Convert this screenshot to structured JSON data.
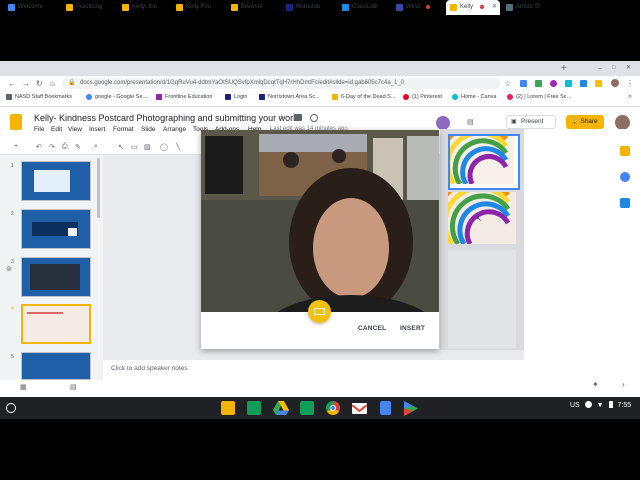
{
  "tabs": [
    {
      "label": "Welcome",
      "color": "#4285f4"
    },
    {
      "label": "Practicing",
      "color": "#f4b400"
    },
    {
      "label": "Kelly: Kin",
      "color": "#f4b400"
    },
    {
      "label": "Kelly Fou",
      "color": "#f4b400"
    },
    {
      "label": "Brewste",
      "color": "#f4b400"
    },
    {
      "label": "Norriston",
      "color": "#1a237e"
    },
    {
      "label": "ClassLink",
      "color": "#1e88e5"
    },
    {
      "label": "WeVi",
      "color": "#3949ab"
    },
    {
      "label": "Kelly",
      "color": "#f4b400"
    },
    {
      "label": "Artists St",
      "color": "#546e7a"
    }
  ],
  "address": {
    "url": "docs.google.com/presentation/d/1GqRuVu4-ddtmYaOtSUQSvfpXmlqDcqtTqH7rHhDmtFc/edit#slide=id.gab605c7c4a_1_0"
  },
  "bookmarks": [
    {
      "label": "NASD Staff Bookmarks",
      "color": "#5f6368"
    },
    {
      "label": "google - Google Se...",
      "color": "#4285f4"
    },
    {
      "label": "Frontline Education",
      "color": "#8e24aa"
    },
    {
      "label": "Login",
      "color": "#1a237e"
    },
    {
      "label": "Norristown Area Sc...",
      "color": "#1a237e"
    },
    {
      "label": "6-Day of the Dead S...",
      "color": "#f4b400"
    },
    {
      "label": "(1) Pinterest",
      "color": "#e60023"
    },
    {
      "label": "Home - Canva",
      "color": "#00c4cc"
    },
    {
      "label": "(2) | Lorem | Free Sc...",
      "color": "#e91e63"
    }
  ],
  "doc": {
    "title": "Kelly- Kindness Postcard  Photographing and submitting your work",
    "last_edit": "Last edit was 14 minutes ago"
  },
  "menu": [
    "File",
    "Edit",
    "View",
    "Insert",
    "Format",
    "Slide",
    "Arrange",
    "Tools",
    "Add-ons",
    "Help"
  ],
  "header_buttons": {
    "present": "Present",
    "share": "Share"
  },
  "filmstrip": {
    "numbers": [
      "1",
      "2",
      "3",
      "4",
      "5"
    ]
  },
  "notes": {
    "placeholder": "Click to add speaker notes"
  },
  "dialog": {
    "cancel": "CANCEL",
    "insert": "INSERT"
  },
  "shelf": {
    "apps": [
      {
        "name": "google-keep",
        "color": "#f4b400"
      },
      {
        "name": "google-sheets",
        "color": "#0f9d58"
      },
      {
        "name": "google-drive",
        "color": "#4285f4"
      },
      {
        "name": "google-classroom",
        "color": "#0f9d58"
      },
      {
        "name": "chrome",
        "color": "#db4437"
      },
      {
        "name": "gmail",
        "color": "#ea4335"
      },
      {
        "name": "google-docs",
        "color": "#4285f4"
      },
      {
        "name": "play-store",
        "color": "#34a853"
      }
    ],
    "locale": "US",
    "time": "7:55"
  }
}
